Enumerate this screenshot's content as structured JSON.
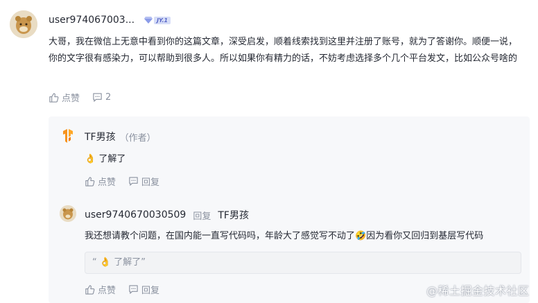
{
  "main_comment": {
    "username": "user974067003...",
    "level_badge": "JY.1",
    "text": "大哥，我在微信上无意中看到你的这篇文章，深受启发，顺着线索找到这里并注册了账号，就为了答谢你。顺便一说，你的文字很有感染力，可以帮助到很多人。所以如果你有精力的话，不妨考虑选择多个几个平台发文，比如公众号啥的",
    "like_label": "点赞",
    "comment_count": "2"
  },
  "replies": [
    {
      "username": "TF男孩",
      "author_tag": "（作者）",
      "emoji": "👌",
      "text": "了解了",
      "like_label": "点赞",
      "reply_label": "回复"
    },
    {
      "username": "user9740670030509",
      "reply_word": "回复",
      "reply_to": "TF男孩",
      "text_before": "我还想请教个问题，在国内能一直写代码吗，年龄大了感觉写不动了",
      "emoji": "🤣",
      "text_after": "因为看你又回归到基层写代码",
      "quote_open": "“",
      "quote_emoji": "👌",
      "quote_text": "了解了”",
      "like_label": "点赞",
      "reply_label": "回复"
    }
  ],
  "watermark": "@稀土掘金技术社区",
  "colors": {
    "text": "#252933",
    "muted": "#8a919f",
    "reply_bg": "#f7f8fa",
    "author_logo": "#f79a1e"
  },
  "icons": [
    "thumbs-up-icon",
    "comment-icon",
    "tf-logo-icon",
    "user-avatar"
  ]
}
